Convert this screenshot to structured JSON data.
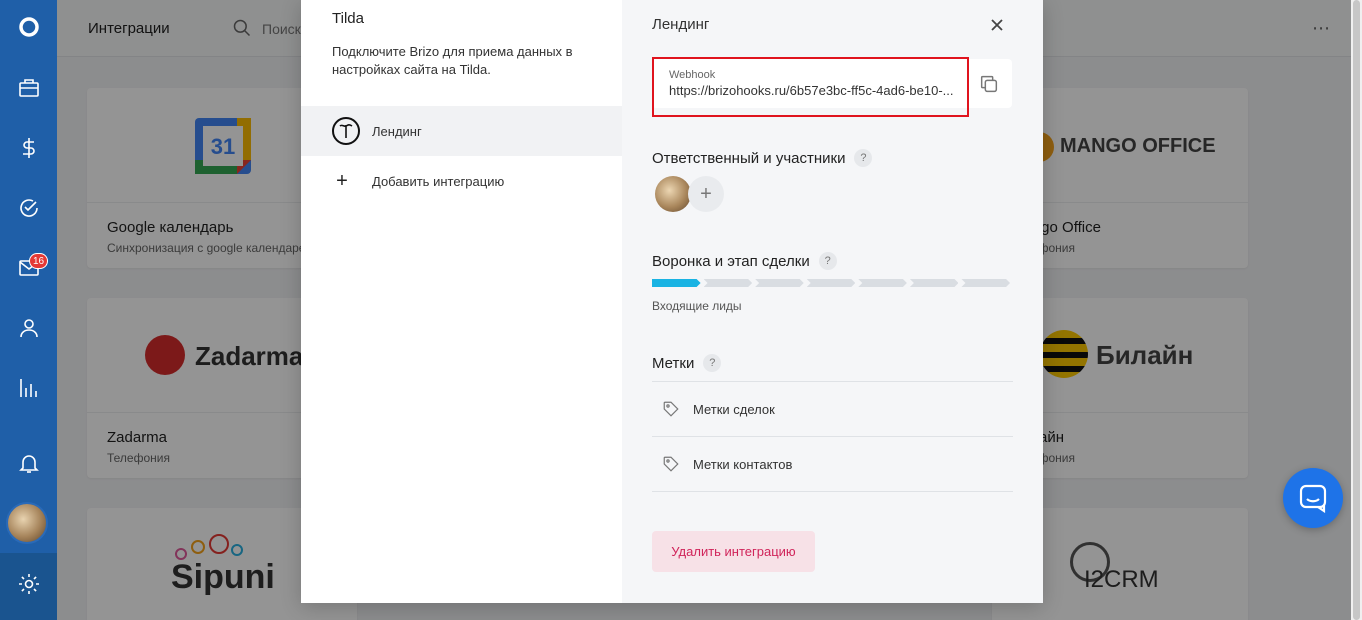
{
  "page": {
    "title": "Интеграции",
    "search_placeholder": "Поиск"
  },
  "sidebar": {
    "mail_badge": "16"
  },
  "cards": [
    {
      "title": "Google календарь",
      "subtitle": "Синхронизация с google календарем"
    },
    {
      "title": "Mango Office",
      "subtitle": "Телефония",
      "logo": "MANGO OFFICE"
    },
    {
      "title": "Zadarma",
      "subtitle": "Телефония",
      "logo": "Zadarma"
    },
    {
      "title": "Билайн",
      "subtitle": "Телефония",
      "logo": "Билайн"
    },
    {
      "logo": "Sipuni"
    },
    {
      "logo": "I2CRM"
    }
  ],
  "modal": {
    "left": {
      "title": "Tilda",
      "description": "Подключите Brizo для приема данных в настройках сайта на Tilda.",
      "items": [
        {
          "label": "Лендинг"
        },
        {
          "label": "Добавить интеграцию"
        }
      ]
    },
    "right": {
      "title": "Лендинг",
      "webhook_label": "Webhook",
      "webhook_url": "https://brizohooks.ru/6b57e3bc-ff5c-4ad6-be10-...",
      "responsible_heading": "Ответственный и участники",
      "funnel_heading": "Воронка и этап сделки",
      "funnel_stage": "Входящие лиды",
      "funnel_stages_total": 7,
      "funnel_stage_active": 1,
      "tags_heading": "Метки",
      "tag_deals": "Метки сделок",
      "tag_contacts": "Метки контактов",
      "delete_label": "Удалить интеграцию",
      "help_mark": "?"
    }
  },
  "colors": {
    "sidebar": "#1f5fa8",
    "accent": "#19b3e3",
    "danger": "#d0245a",
    "highlight": "#e0141e"
  }
}
